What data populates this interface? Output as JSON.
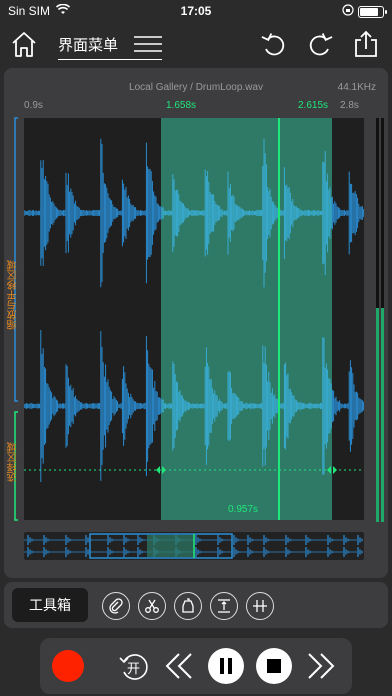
{
  "status_bar": {
    "carrier": "Sin SIM",
    "time": "17:05"
  },
  "header": {
    "menu_label": "界面菜单"
  },
  "editor": {
    "file_title": "Local Gallery / DrumLoop.wav",
    "sample_rate": "44.1KHz",
    "time_start": "0.9s",
    "selection_start": "1.658s",
    "playhead": "2.615s",
    "time_end": "2.8s",
    "selection_duration": "0.957s",
    "side_label_zoom": "缩放与平移区域",
    "side_label_select": "选择区域"
  },
  "tools": {
    "toolbox_label": "工具箱",
    "icons": [
      "paperclip-icon",
      "scissors-icon",
      "eraser-icon",
      "trim-icon",
      "split-icon"
    ]
  },
  "transport": {
    "toggle_label": "开"
  },
  "colors": {
    "accent": "#1fe87a",
    "selection": "#2e7a66",
    "wave": "#2a8fd6",
    "record": "#ff2200",
    "side_label": "#e88a1d"
  }
}
